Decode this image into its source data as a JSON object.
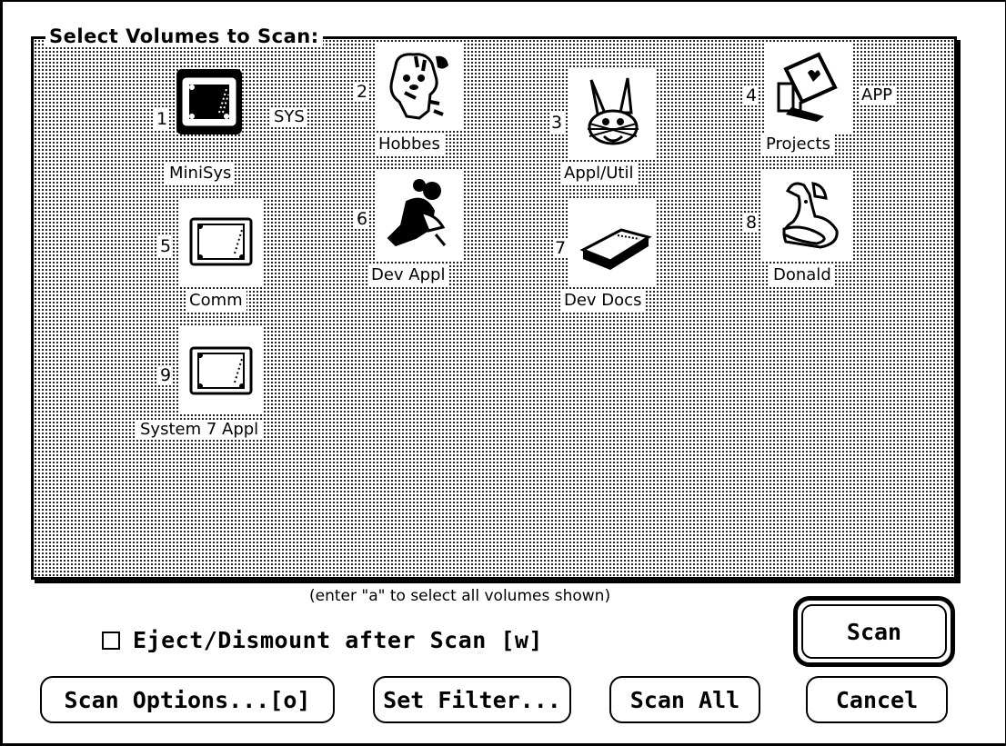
{
  "panel": {
    "title": "Select Volumes to Scan:"
  },
  "volumes": [
    {
      "num": "1",
      "label": "MiniSys",
      "tag": "SYS",
      "icon": "hard-disk-icon",
      "selected": true
    },
    {
      "num": "2",
      "label": "Hobbes",
      "icon": "tiger-cartoon-icon"
    },
    {
      "num": "3",
      "label": "Appl/Util",
      "icon": "rabbit-cartoon-icon"
    },
    {
      "num": "4",
      "label": "Projects",
      "tag": "APP",
      "icon": "computer-heart-icon"
    },
    {
      "num": "5",
      "label": "Comm",
      "icon": "hard-disk-icon"
    },
    {
      "num": "6",
      "label": "Dev Appl",
      "icon": "mouse-cartoon-icon"
    },
    {
      "num": "7",
      "label": "Dev Docs",
      "icon": "book-icon"
    },
    {
      "num": "8",
      "label": "Donald",
      "icon": "duck-cartoon-icon"
    },
    {
      "num": "9",
      "label": "System 7 Appl",
      "icon": "hard-disk-icon"
    }
  ],
  "hint": "(enter \"a\" to select all volumes shown)",
  "eject": {
    "label": "Eject/Dismount after Scan [w]",
    "checked": false
  },
  "buttons": {
    "scan": "Scan",
    "scan_options": "Scan Options...[o]",
    "set_filter": "Set Filter...",
    "scan_all": "Scan All",
    "cancel": "Cancel"
  }
}
